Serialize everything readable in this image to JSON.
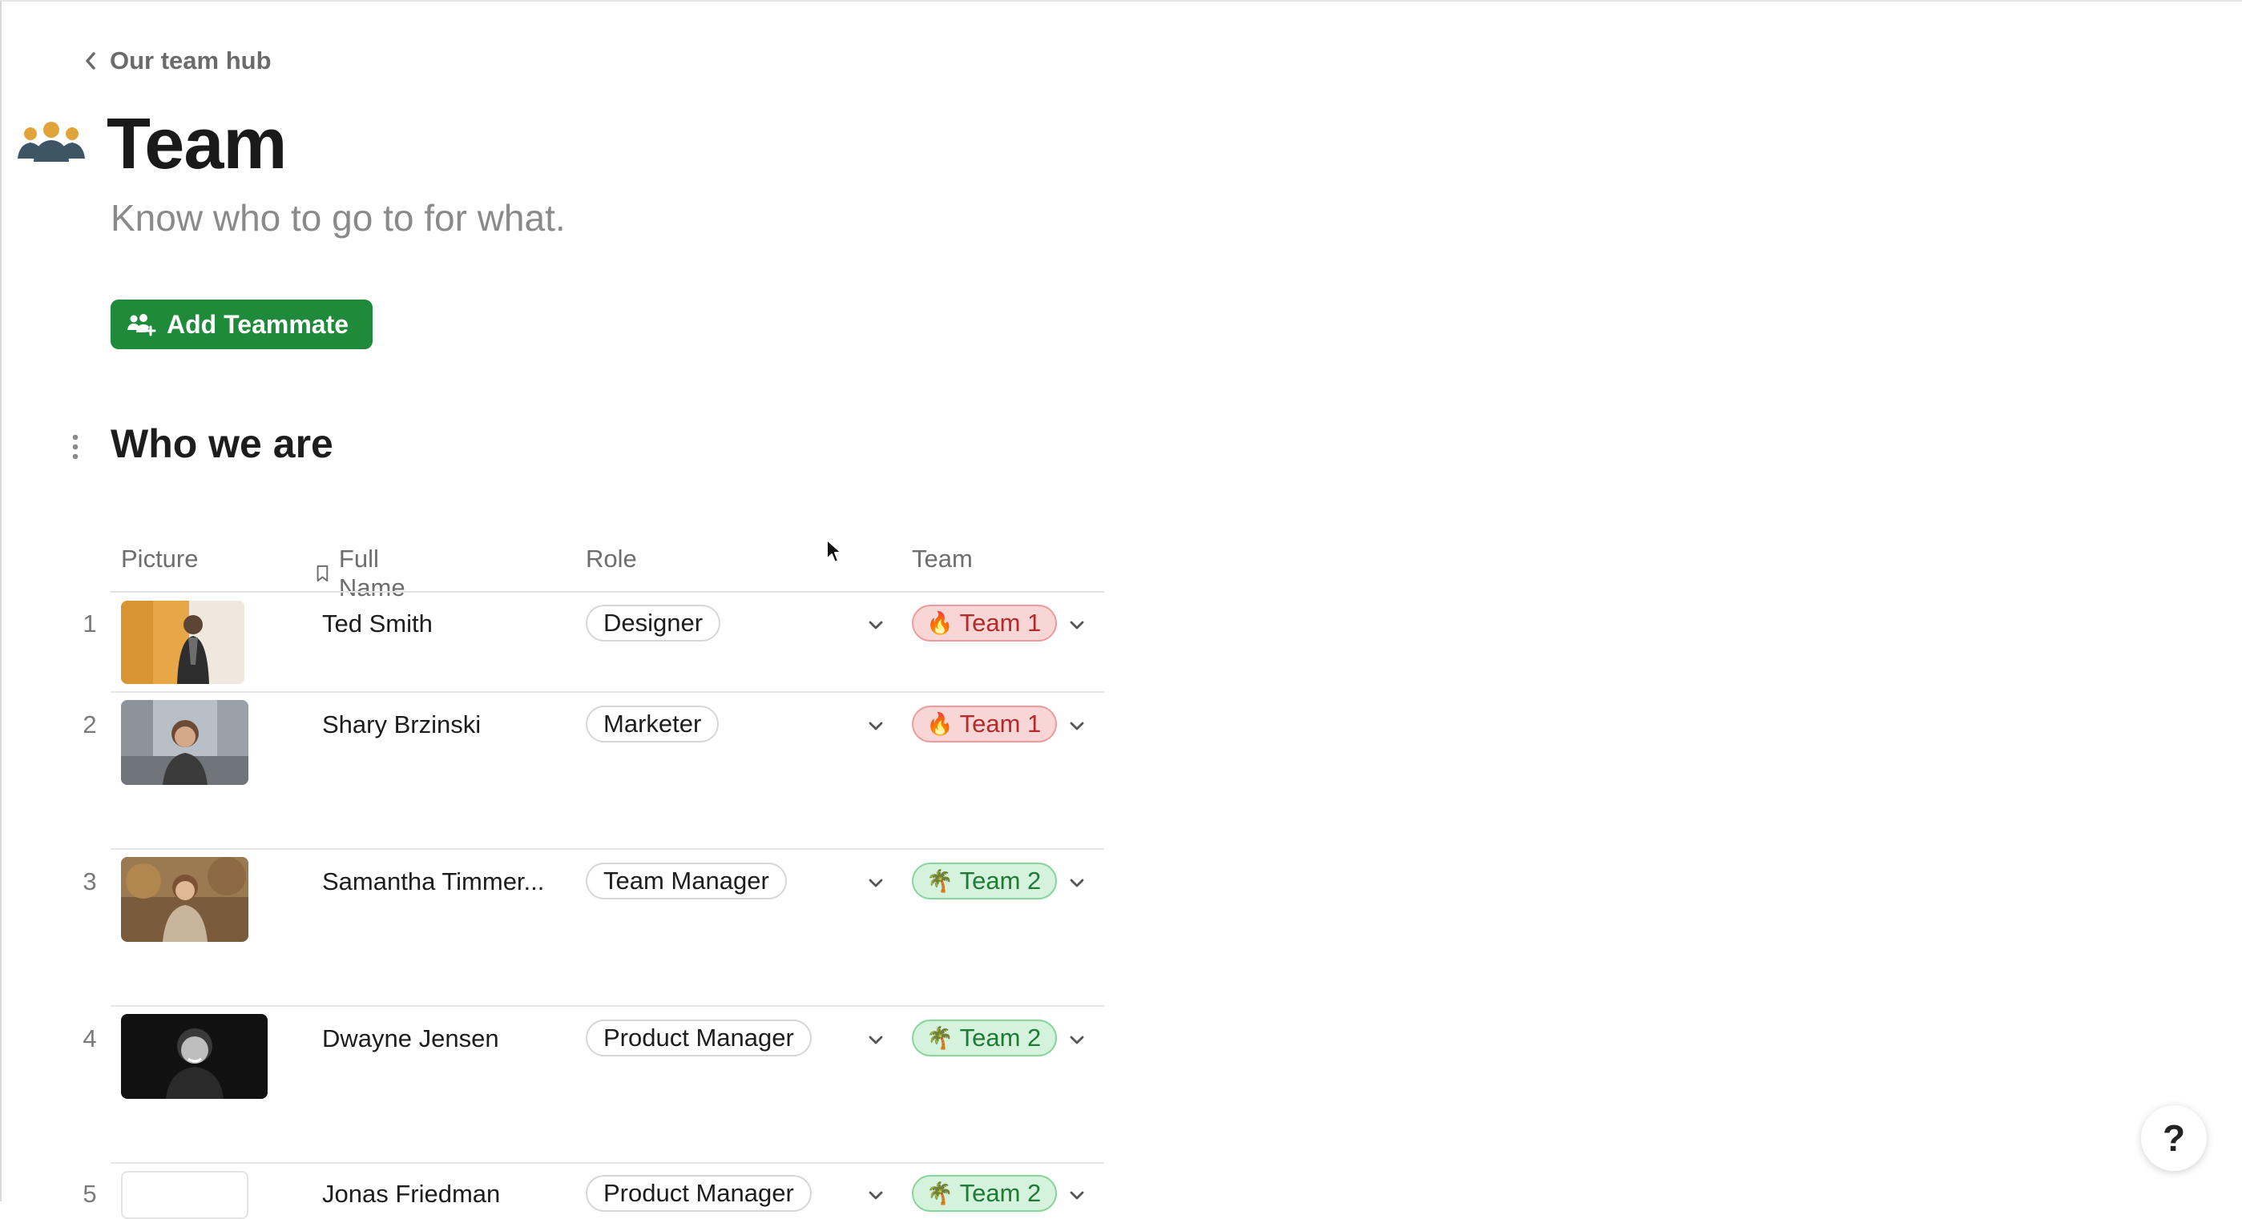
{
  "breadcrumb": {
    "label": "Our team hub"
  },
  "page": {
    "title": "Team",
    "subtitle": "Know who to go to for what.",
    "add_button_label": "Add Teammate"
  },
  "section": {
    "title": "Who we are"
  },
  "table": {
    "columns": {
      "picture": "Picture",
      "full_name": "Full Name",
      "role": "Role",
      "team": "Team"
    },
    "rows": [
      {
        "num": "1",
        "name": "Ted Smith",
        "role": "Designer",
        "team": "Team 1",
        "team_emoji": "🔥"
      },
      {
        "num": "2",
        "name": "Shary Brzinski",
        "role": "Marketer",
        "team": "Team 1",
        "team_emoji": "🔥"
      },
      {
        "num": "3",
        "name": "Samantha Timmer...",
        "role": "Team Manager",
        "team": "Team 2",
        "team_emoji": "🌴"
      },
      {
        "num": "4",
        "name": "Dwayne Jensen",
        "role": "Product Manager",
        "team": "Team 2",
        "team_emoji": "🌴"
      },
      {
        "num": "5",
        "name": "Jonas Friedman",
        "role": "Product Manager",
        "team": "Team 2",
        "team_emoji": "🌴"
      }
    ]
  },
  "help": {
    "label": "?"
  },
  "colors": {
    "accent_green": "#1e8a3a",
    "team1_bg": "#f9d6d6",
    "team1_text": "#b32b2b",
    "team2_bg": "#d5f3dc",
    "team2_text": "#1f7a35",
    "title_icon": "#e0a43a"
  }
}
